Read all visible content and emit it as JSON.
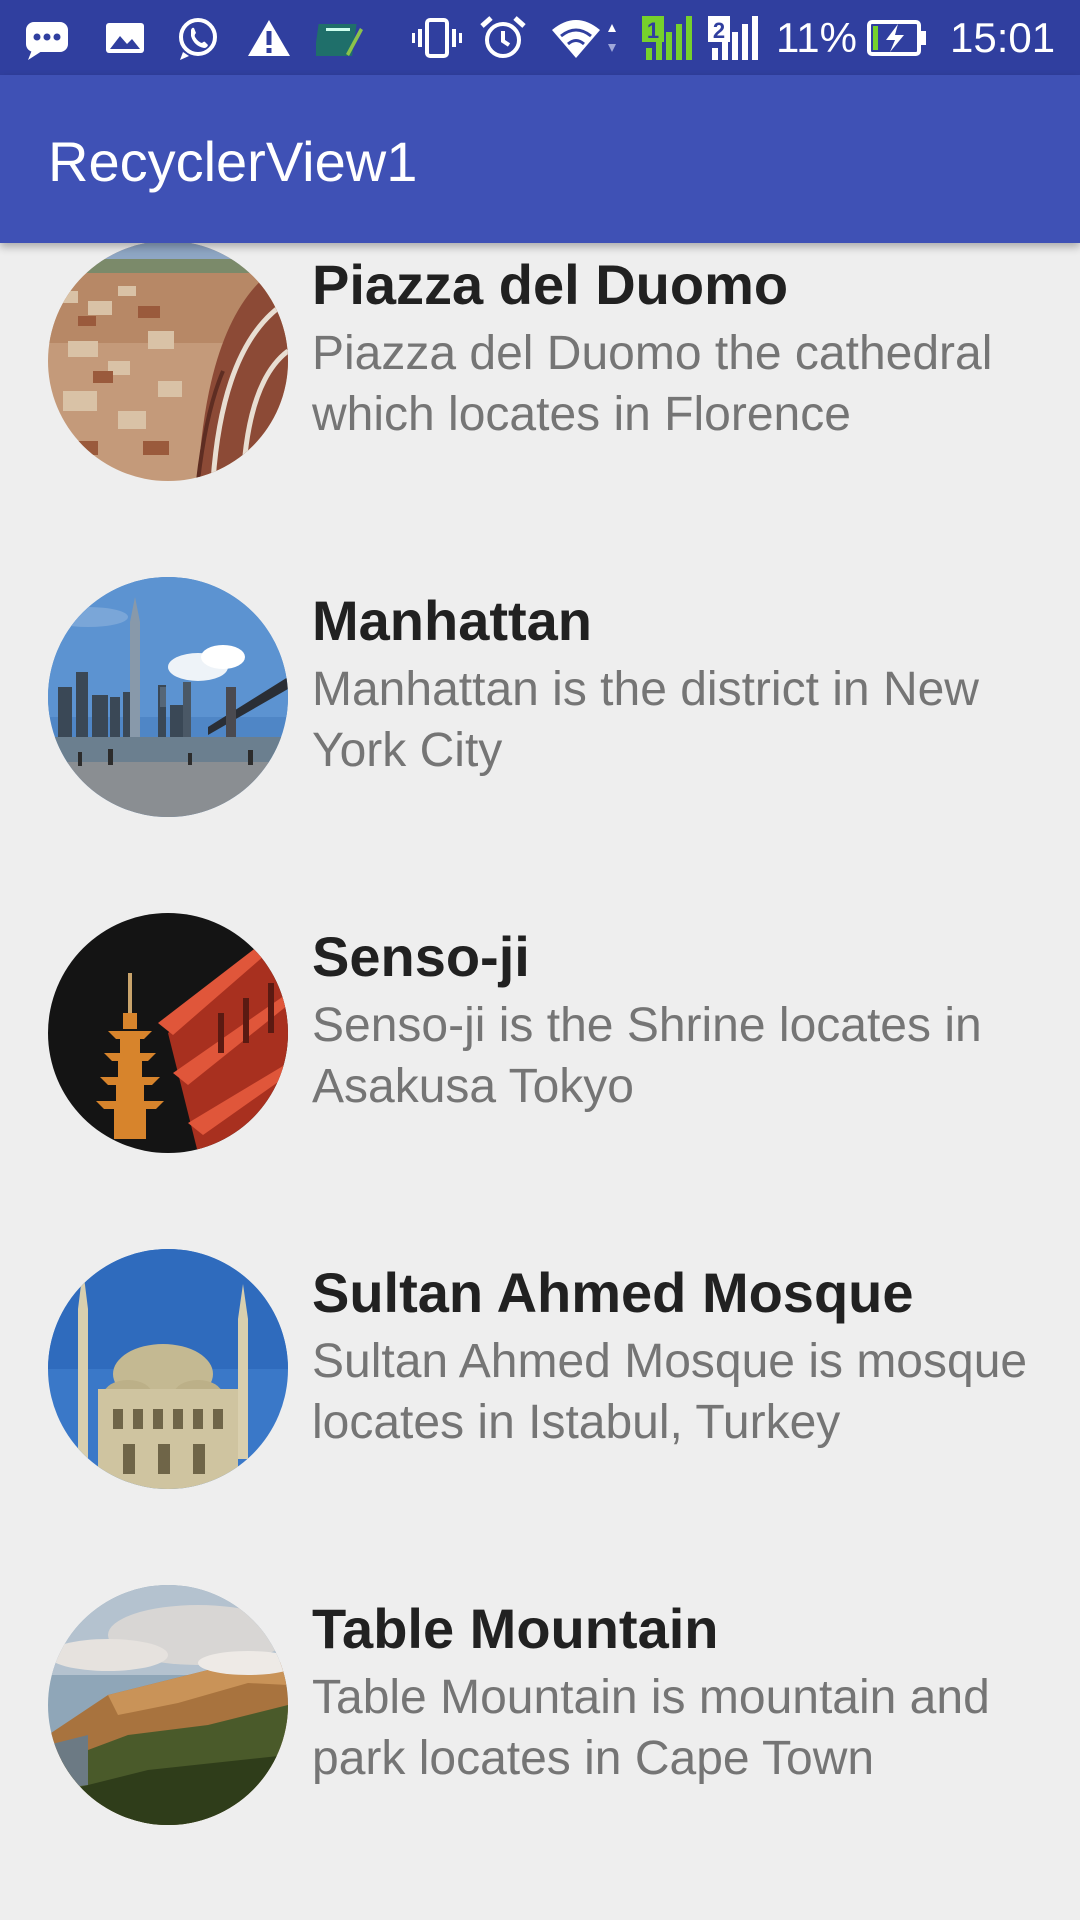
{
  "status_bar": {
    "battery_percent": "11%",
    "time": "15:01",
    "sim_labels": [
      "1",
      "2"
    ],
    "icons": [
      "chat-bubble-icon",
      "image-icon",
      "whatsapp-icon",
      "warning-icon",
      "notebook-icon",
      "vibrate-icon",
      "alarm-icon",
      "wifi-icon",
      "signal-sim1-icon",
      "signal-sim2-icon",
      "battery-charging-icon"
    ]
  },
  "app_bar": {
    "title": "RecyclerView1"
  },
  "colors": {
    "status_bar": "#303f9f",
    "app_bar": "#3f51b5",
    "background": "#eeeeee",
    "title_text": "#212121",
    "description_text": "#757575"
  },
  "list": {
    "items": [
      {
        "title": "Piazza del Duomo",
        "description": "Piazza del Duomo the cathedral which locates in Florence",
        "image": "duomo-photo"
      },
      {
        "title": "Manhattan",
        "description": "Manhattan is the district in New York City",
        "image": "manhattan-photo"
      },
      {
        "title": "Senso-ji",
        "description": "Senso-ji is the Shrine locates in Asakusa Tokyo",
        "image": "sensoji-photo"
      },
      {
        "title": "Sultan Ahmed Mosque",
        "description": "Sultan Ahmed Mosque is mosque locates in Istabul, Turkey",
        "image": "mosque-photo"
      },
      {
        "title": "Table Mountain",
        "description": "Table Mountain is mountain and park locates in Cape Town",
        "image": "mountain-photo"
      }
    ]
  }
}
